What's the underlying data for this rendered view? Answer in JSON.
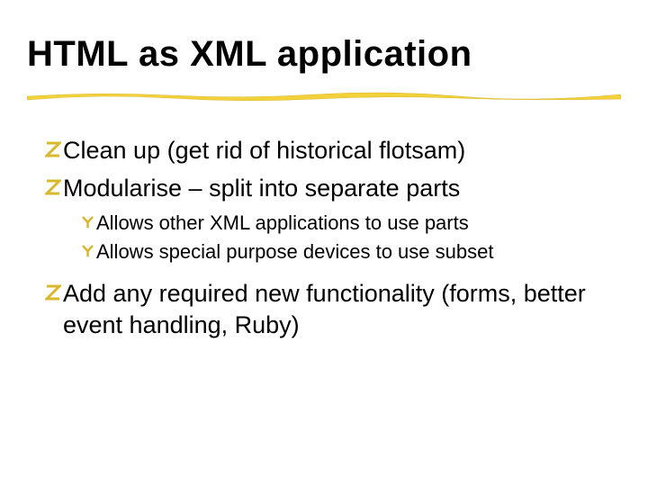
{
  "title": "HTML as XML application",
  "bullets": [
    {
      "text": "Clean up (get rid of historical flotsam)",
      "sub": []
    },
    {
      "text": "Modularise – split into separate parts",
      "sub": [
        "Allows other XML applications to use parts",
        "Allows special purpose devices to use subset"
      ]
    },
    {
      "text": "Add any required new functionality (forms, better event handling, Ruby)",
      "sub": []
    }
  ]
}
